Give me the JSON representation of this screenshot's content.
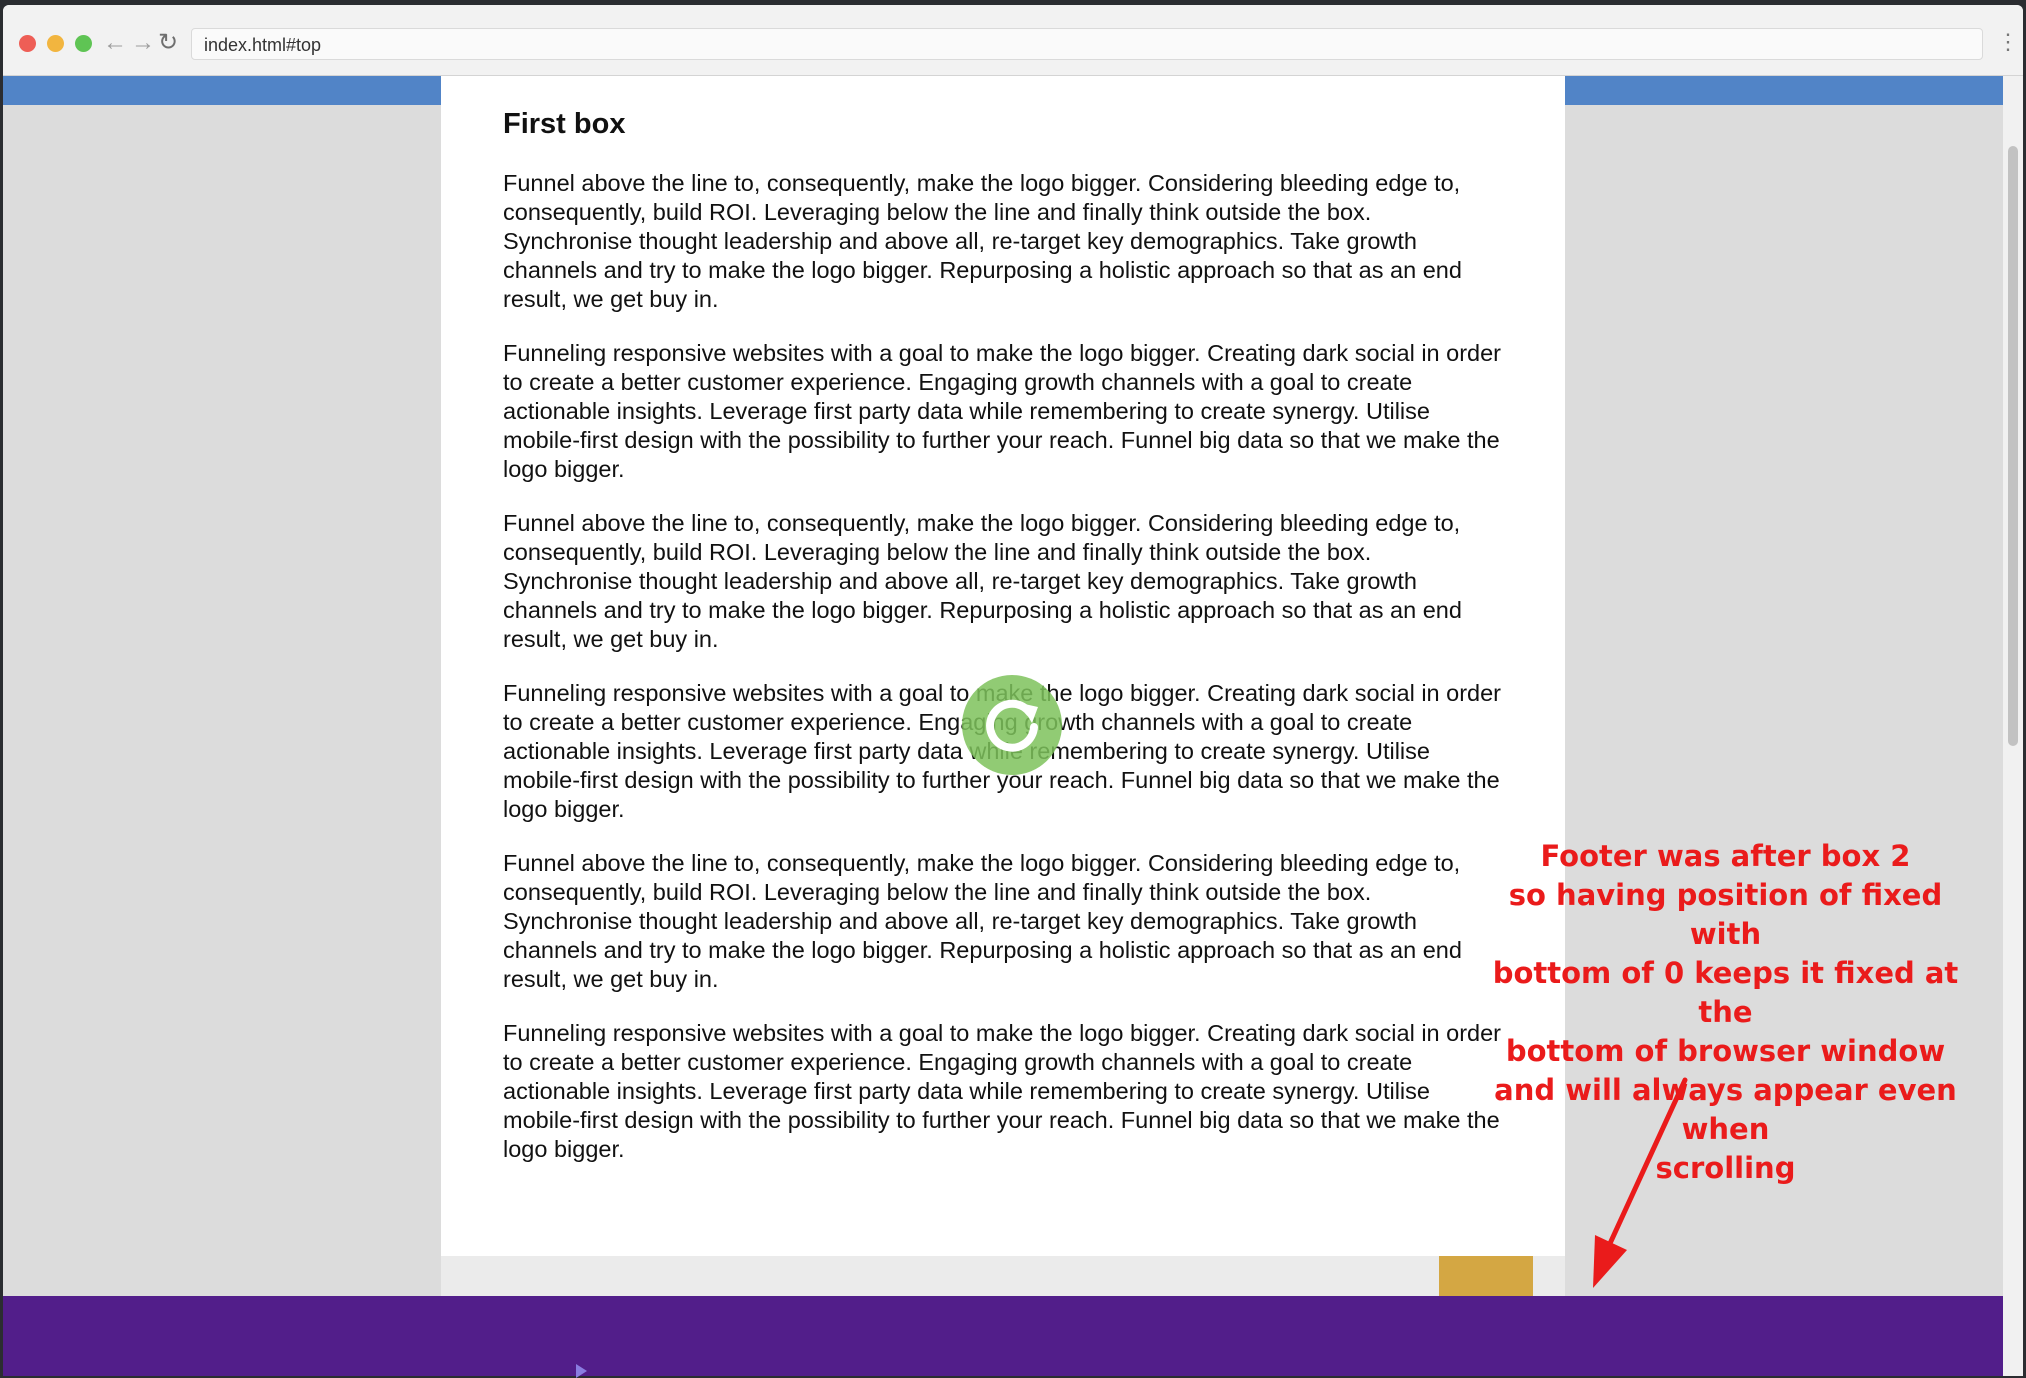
{
  "browser": {
    "url": "index.html#top",
    "icons": {
      "back": "arrow-left-icon",
      "forward": "arrow-right-icon",
      "reload": "reload-icon",
      "menu": "more-vertical-icon"
    }
  },
  "page": {
    "box1": {
      "title": "First box",
      "paragraphs": [
        "Funnel above the line to, consequently, make the logo bigger. Considering bleeding edge to, consequently, build ROI. Leveraging below the line and finally think outside the box. Synchronise thought leadership and above all, re-target key demographics. Take growth channels and try to make the logo bigger. Repurposing a holistic approach so that as an end result, we get buy in.",
        "Funneling responsive websites with a goal to make the logo bigger. Creating dark social in order to create a better customer experience. Engaging growth channels with a goal to create actionable insights. Leverage first party data while remembering to create synergy. Utilise mobile-first design with the possibility to further your reach. Funnel big data so that we make the logo bigger.",
        "Funnel above the line to, consequently, make the logo bigger. Considering bleeding edge to, consequently, build ROI. Leveraging below the line and finally think outside the box. Synchronise thought leadership and above all, re-target key demographics. Take growth channels and try to make the logo bigger. Repurposing a holistic approach so that as an end result, we get buy in.",
        "Funneling responsive websites with a goal to make the logo bigger. Creating dark social in order to create a better customer experience. Engaging growth channels with a goal to create actionable insights. Leverage first party data while remembering to create synergy. Utilise mobile-first design with the possibility to further your reach. Funnel big data so that we make the logo bigger.",
        "Funnel above the line to, consequently, make the logo bigger. Considering bleeding edge to, consequently, build ROI. Leveraging below the line and finally think outside the box. Synchronise thought leadership and above all, re-target key demographics. Take growth channels and try to make the logo bigger. Repurposing a holistic approach so that as an end result, we get buy in.",
        "Funneling responsive websites with a goal to make the logo bigger. Creating dark social in order to create a better customer experience. Engaging growth channels with a goal to create actionable insights. Leverage first party data while remembering to create synergy. Utilise mobile-first design with the possibility to further your reach. Funnel big data so that we make the logo bigger."
      ]
    }
  },
  "annotation": {
    "lines": [
      "Footer was after box 2",
      "so having position of fixed with",
      "bottom of 0 keeps it fixed at the",
      "bottom of browser window",
      "and will always appear even when",
      "scrolling"
    ]
  },
  "colors": {
    "header_band": "#5184c7",
    "footer": "#521e8a",
    "box2_accent": "#d4a743",
    "annotation": "#ea1b1b",
    "reload_overlay": "#7ec25c"
  },
  "overlay": {
    "icon": "reload-icon"
  }
}
